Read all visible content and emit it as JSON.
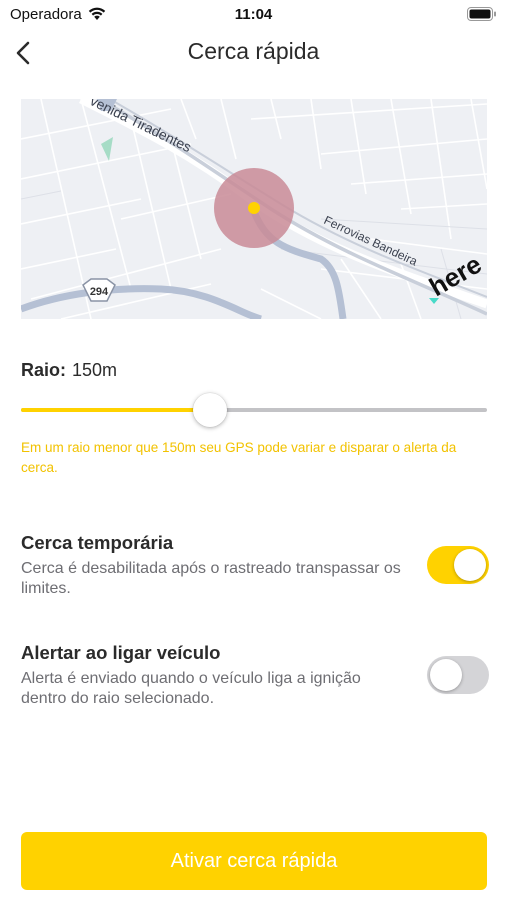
{
  "status_bar": {
    "carrier": "Operadora",
    "time": "11:04",
    "wifi_icon": "wifi-icon",
    "battery_icon": "battery-icon"
  },
  "nav": {
    "back_icon": "chevron-left-icon",
    "title": "Cerca rápida"
  },
  "map": {
    "street_labels": [
      "venida Tiradentes",
      "Ferrovias Bandeira"
    ],
    "route_shield": "294",
    "brand": "here",
    "fence_color": "#c98b96",
    "center_color": "#ffd200"
  },
  "radius": {
    "label": "Raio:",
    "value": "150m",
    "slider_fraction": 0.405,
    "warning": "Em um raio menor que 150m seu GPS pode variar e disparar o alerta da cerca."
  },
  "settings": [
    {
      "title": "Cerca temporária",
      "description": "Cerca é desabilitada após o rastreado transpassar os limites.",
      "enabled": true
    },
    {
      "title": "Alertar ao ligar veículo",
      "description": "Alerta é enviado quando o veículo liga a ignição dentro do raio selecionado.",
      "enabled": false
    }
  ],
  "cta": {
    "label": "Ativar cerca rápida"
  },
  "colors": {
    "accent": "#ffd200",
    "warning_text": "#f2c200",
    "toggle_off": "#d4d4d7"
  }
}
